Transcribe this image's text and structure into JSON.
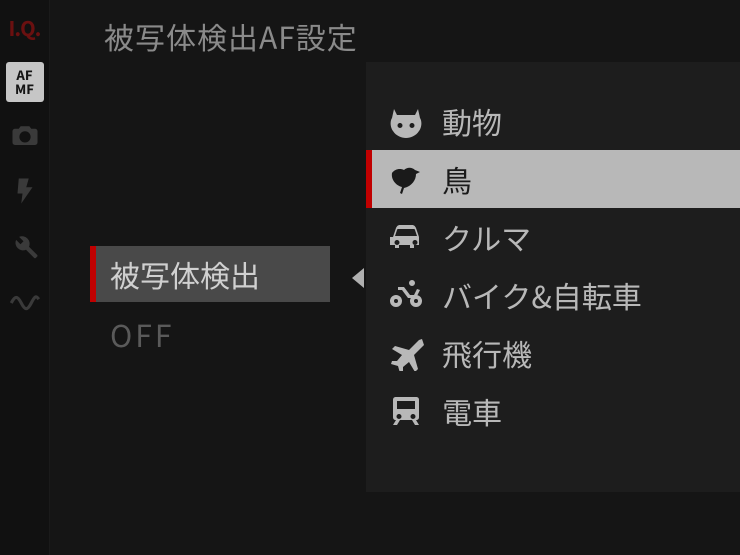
{
  "title": "被写体検出AF設定",
  "tabs": {
    "iq": "I.Q.",
    "afmf_top": "AF",
    "afmf_bottom": "MF"
  },
  "main_entry": {
    "selected_label": "被写体検出",
    "off_label": "OFF"
  },
  "submenu": {
    "items": [
      {
        "name": "animal",
        "icon": "animal",
        "label": "動物",
        "selected": false
      },
      {
        "name": "bird",
        "icon": "bird",
        "label": "鳥",
        "selected": true
      },
      {
        "name": "car",
        "icon": "car",
        "label": "クルマ",
        "selected": false
      },
      {
        "name": "bike",
        "icon": "bike",
        "label": "バイク&自転車",
        "selected": false
      },
      {
        "name": "plane",
        "icon": "plane",
        "label": "飛行機",
        "selected": false
      },
      {
        "name": "train",
        "icon": "train",
        "label": "電車",
        "selected": false
      }
    ]
  }
}
